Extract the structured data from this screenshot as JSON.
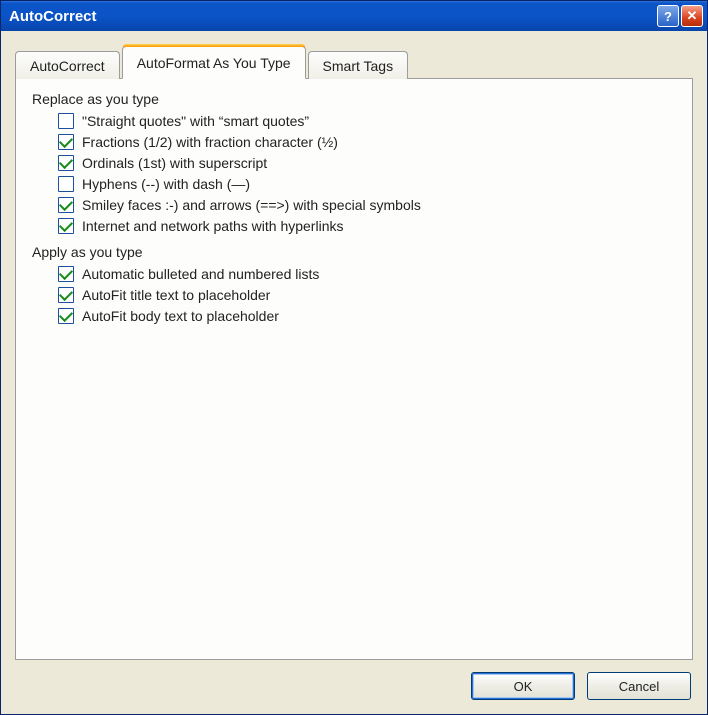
{
  "title": "AutoCorrect",
  "titlebar": {
    "help_symbol": "?",
    "close_symbol": "✕"
  },
  "tabs": [
    {
      "label": "AutoCorrect",
      "active": false
    },
    {
      "label": "AutoFormat As You Type",
      "active": true
    },
    {
      "label": "Smart Tags",
      "active": false
    }
  ],
  "groups": [
    {
      "label": "Replace as you type",
      "options": [
        {
          "label": "\"Straight quotes\" with “smart quotes”",
          "checked": false
        },
        {
          "label": "Fractions (1/2) with fraction character (½)",
          "checked": true
        },
        {
          "label": "Ordinals (1st) with superscript",
          "checked": true
        },
        {
          "label": "Hyphens (--) with dash (—)",
          "checked": false
        },
        {
          "label": "Smiley faces :-) and arrows (==>) with special symbols",
          "checked": true
        },
        {
          "label": "Internet and network paths with hyperlinks",
          "checked": true
        }
      ]
    },
    {
      "label": "Apply as you type",
      "options": [
        {
          "label": "Automatic bulleted and numbered lists",
          "checked": true
        },
        {
          "label": "AutoFit title text to placeholder",
          "checked": true
        },
        {
          "label": "AutoFit body text to placeholder",
          "checked": true
        }
      ]
    }
  ],
  "buttons": {
    "ok": "OK",
    "cancel": "Cancel"
  }
}
